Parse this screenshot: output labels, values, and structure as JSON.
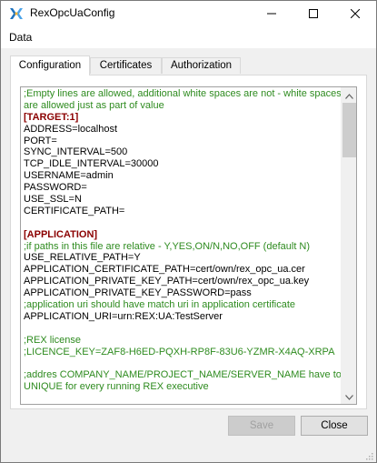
{
  "window": {
    "title": "RexOpcUaConfig",
    "app_icon": "rex-app-icon",
    "controls": {
      "minimize_icon": "minimize-icon",
      "maximize_icon": "maximize-icon",
      "close_icon": "close-icon"
    }
  },
  "menu": {
    "items": [
      {
        "label": "Data"
      }
    ]
  },
  "tabs": [
    {
      "label": "Configuration",
      "active": true
    },
    {
      "label": "Certificates",
      "active": false
    },
    {
      "label": "Authorization",
      "active": false
    }
  ],
  "editor": {
    "lines": [
      {
        "text": ";Empty lines are allowed, additional white spaces are not - white spaces",
        "kind": "comment"
      },
      {
        "text": "are allowed just as part of value",
        "kind": "comment"
      },
      {
        "text": "[TARGET:1]",
        "kind": "section"
      },
      {
        "text": "ADDRESS=localhost",
        "kind": "normal"
      },
      {
        "text": "PORT=",
        "kind": "normal"
      },
      {
        "text": "SYNC_INTERVAL=500",
        "kind": "normal"
      },
      {
        "text": "TCP_IDLE_INTERVAL=30000",
        "kind": "normal"
      },
      {
        "text": "USERNAME=admin",
        "kind": "normal"
      },
      {
        "text": "PASSWORD=",
        "kind": "normal"
      },
      {
        "text": "USE_SSL=N",
        "kind": "normal"
      },
      {
        "text": "CERTIFICATE_PATH=",
        "kind": "normal"
      },
      {
        "text": "",
        "kind": "normal"
      },
      {
        "text": "[APPLICATION]",
        "kind": "section"
      },
      {
        "text": ";if paths in this file are relative - Y,YES,ON/N,NO,OFF (default N)",
        "kind": "comment"
      },
      {
        "text": "USE_RELATIVE_PATH=Y",
        "kind": "normal"
      },
      {
        "text": "APPLICATION_CERTIFICATE_PATH=cert/own/rex_opc_ua.cer",
        "kind": "normal"
      },
      {
        "text": "APPLICATION_PRIVATE_KEY_PATH=cert/own/rex_opc_ua.key",
        "kind": "normal"
      },
      {
        "text": "APPLICATION_PRIVATE_KEY_PASSWORD=pass",
        "kind": "normal"
      },
      {
        "text": ";application uri should have match uri in application certificate",
        "kind": "comment"
      },
      {
        "text": "APPLICATION_URI=urn:REX:UA:TestServer",
        "kind": "normal"
      },
      {
        "text": "",
        "kind": "normal"
      },
      {
        "text": ";REX license",
        "kind": "comment"
      },
      {
        "text": ";LICENCE_KEY=ZAF8-H6ED-PQXH-RP8F-83U6-YZMR-X4AQ-XRPA",
        "kind": "comment"
      },
      {
        "text": "",
        "kind": "normal"
      },
      {
        "text": ";addres COMPANY_NAME/PROJECT_NAME/SERVER_NAME have to be",
        "kind": "comment"
      },
      {
        "text": "UNIQUE for every running REX executive",
        "kind": "comment"
      }
    ],
    "scroll_up_icon": "scroll-up-arrow-icon",
    "scroll_down_icon": "scroll-down-arrow-icon"
  },
  "buttons": {
    "save_label": "Save",
    "close_label": "Close"
  },
  "colors": {
    "comment": "#2e8b1f",
    "section": "#8b0000",
    "text": "#000000"
  }
}
